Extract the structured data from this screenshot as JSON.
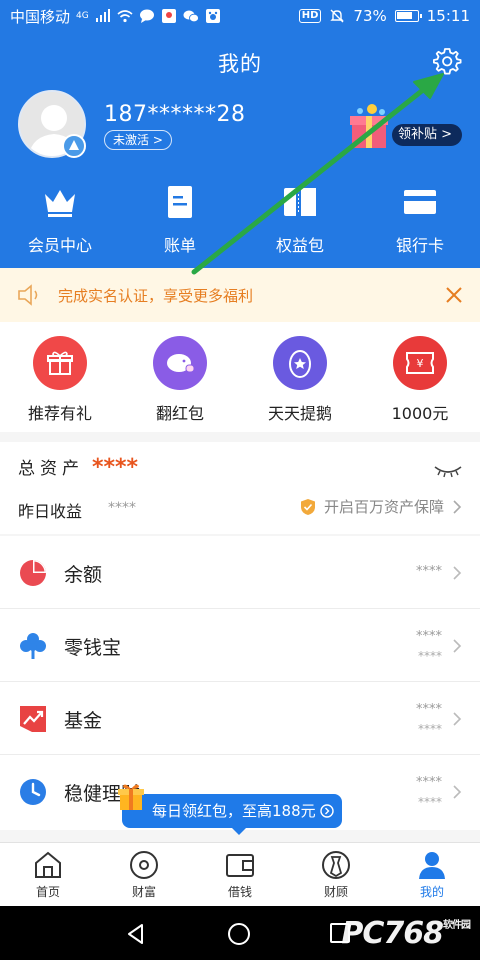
{
  "status_bar": {
    "carrier": "中国移动",
    "network": "4G",
    "battery": "73%",
    "time": "15:11",
    "hd_badge": "HD"
  },
  "header": {
    "title": "我的",
    "phone": "187******28",
    "not_activated": "未激活 >",
    "subsidy": "领补贴 >"
  },
  "quick_actions": [
    {
      "label": "会员中心",
      "icon": "crown-icon"
    },
    {
      "label": "账单",
      "icon": "bill-icon"
    },
    {
      "label": "权益包",
      "icon": "coupon-icon"
    },
    {
      "label": "银行卡",
      "icon": "bank-card-icon"
    }
  ],
  "notice": {
    "text": "完成实名认证，享受更多福利"
  },
  "services": [
    {
      "label": "推荐有礼",
      "color": "#f04848",
      "icon": "gift-icon"
    },
    {
      "label": "翻红包",
      "color": "#8a5ce6",
      "icon": "piggy-icon"
    },
    {
      "label": "天天提鹅",
      "color": "#6a5ae0",
      "icon": "egg-star-icon"
    },
    {
      "label": "1000元",
      "color": "#e83a3a",
      "icon": "yuan-ticket-icon"
    }
  ],
  "assets": {
    "total_label": "总资产",
    "total_value": "****",
    "yesterday_label": "昨日收益",
    "yesterday_value": "****",
    "protection": "开启百万资产保障"
  },
  "list": [
    {
      "name": "余额",
      "value1": "****",
      "value2": "",
      "icon": "pie-chart-icon"
    },
    {
      "name": "零钱宝",
      "value1": "****",
      "value2": "****",
      "icon": "clover-icon"
    },
    {
      "name": "基金",
      "value1": "****",
      "value2": "****",
      "icon": "trend-icon"
    },
    {
      "name": "稳健理财",
      "value1": "****",
      "value2": "****",
      "icon": "clock-icon"
    }
  ],
  "promo": {
    "text": "每日领红包，至高188元"
  },
  "tabs": [
    {
      "label": "首页",
      "icon": "home-icon",
      "active": false
    },
    {
      "label": "财富",
      "icon": "wealth-icon",
      "active": false
    },
    {
      "label": "借钱",
      "icon": "wallet-icon",
      "active": false
    },
    {
      "label": "财顾",
      "icon": "advisor-icon",
      "active": false
    },
    {
      "label": "我的",
      "icon": "user-icon",
      "active": true
    }
  ],
  "watermark": {
    "text": "PC768",
    "sub": "软件园"
  },
  "colors": {
    "brand_blue": "#2379e3",
    "notice_orange": "#e67e22",
    "arrow_green": "#2aa845"
  }
}
